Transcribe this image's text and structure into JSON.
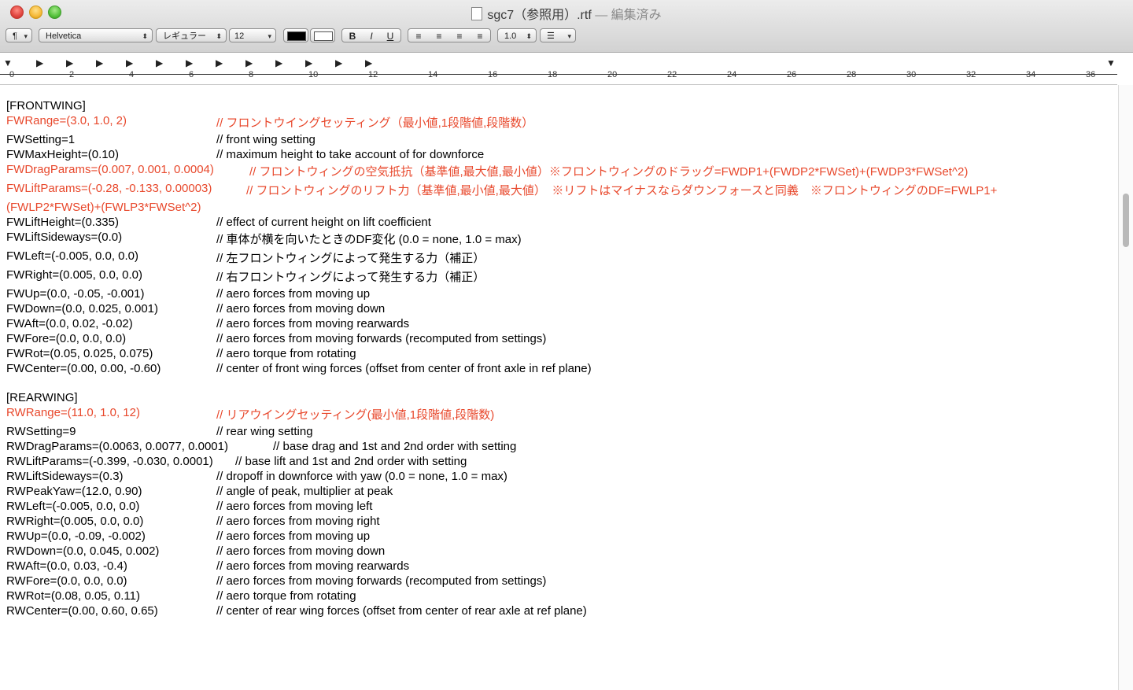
{
  "window": {
    "title": "sgc7（参照用）.rtf",
    "edited": "— 編集済み"
  },
  "toolbar": {
    "paragraph_btn": "¶",
    "font_family": "Helvetica",
    "font_style": "レギュラー",
    "font_size": "12",
    "bold": "B",
    "italic": "I",
    "underline": "U",
    "line_spacing": "1.0",
    "list_btn": "☰"
  },
  "ruler": {
    "labels": [
      "0",
      "2",
      "4",
      "6",
      "8",
      "10",
      "12",
      "14",
      "16",
      "18",
      "20",
      "22",
      "24",
      "26",
      "28",
      "30",
      "32",
      "34",
      "36"
    ]
  },
  "doc": {
    "frontwing_header": "[FRONTWING]",
    "l1_k": "FWRange=(3.0, 1.0, 2)",
    "l1_c": "// フロントウイングセッティング（最小値,1段階値,段階数）",
    "l2_k": "FWSetting=1",
    "l2_c": "// front wing setting",
    "l3_k": "FWMaxHeight=(0.10)",
    "l3_c": "// maximum height to take account of for downforce",
    "l4_k": "FWDragParams=(0.007, 0.001, 0.0004)",
    "l4_c": "// フロントウィングの空気抵抗（基準値,最大値,最小値）※フロントウィングのドラッグ=FWDP1+(FWDP2*FWSet)+(FWDP3*FWSet^2)",
    "l5_k": "FWLiftParams=(-0.28, -0.133, 0.00003)",
    "l5_c": "// フロントウィングのリフト力（基準値,最小値,最大値）　※リフトはマイナスならダウンフォースと同義　※フロントウィングのDF=FWLP1+",
    "l5b": "(FWLP2*FWSet)+(FWLP3*FWSet^2)",
    "l6_k": "FWLiftHeight=(0.335)",
    "l6_c": "// effect of current height on lift coefficient",
    "l7_k": "FWLiftSideways=(0.0)",
    "l7_c": "// 車体が横を向いたときのDF変化 (0.0 = none, 1.0 = max)",
    "l8_k": "FWLeft=(-0.005, 0.0, 0.0)",
    "l8_c": "// 左フロントウィングによって発生する力（補正）",
    "l9_k": "FWRight=(0.005, 0.0, 0.0)",
    "l9_c": "// 右フロントウィングによって発生する力（補正）",
    "l10_k": "FWUp=(0.0, -0.05, -0.001)",
    "l10_c": "// aero forces from moving up",
    "l11_k": "FWDown=(0.0, 0.025, 0.001)",
    "l11_c": "// aero forces from moving down",
    "l12_k": "FWAft=(0.0, 0.02, -0.02)",
    "l12_c": "// aero forces from moving rearwards",
    "l13_k": "FWFore=(0.0, 0.0, 0.0)",
    "l13_c": "// aero forces from moving forwards (recomputed from settings)",
    "l14_k": "FWRot=(0.05, 0.025, 0.075)",
    "l14_c": "// aero torque from rotating",
    "l15_k": "FWCenter=(0.00, 0.00, -0.60)",
    "l15_c": "// center of front wing forces (offset from center of front axle in ref plane)",
    "rearwing_header": "[REARWING]",
    "r1_k": "RWRange=(11.0, 1.0, 12)",
    "r1_c": "// リアウイングセッティング(最小値,1段階値,段階数)",
    "r2_k": "RWSetting=9",
    "r2_c": "// rear wing setting",
    "r3_k": "RWDragParams=(0.0063, 0.0077, 0.0001)",
    "r3_c": "// base drag and 1st and 2nd order with setting",
    "r4_k": "RWLiftParams=(-0.399, -0.030, 0.0001)",
    "r4_c": "// base lift and 1st and 2nd order with setting",
    "r5_k": "RWLiftSideways=(0.3)",
    "r5_c": "// dropoff in downforce with yaw (0.0 = none, 1.0 = max)",
    "r6_k": "RWPeakYaw=(12.0, 0.90)",
    "r6_c": "// angle of peak, multiplier at peak",
    "r7_k": "RWLeft=(-0.005, 0.0, 0.0)",
    "r7_c": "// aero forces from moving left",
    "r8_k": "RWRight=(0.005, 0.0, 0.0)",
    "r8_c": "// aero forces from moving right",
    "r9_k": "RWUp=(0.0, -0.09, -0.002)",
    "r9_c": "// aero forces from moving up",
    "r10_k": "RWDown=(0.0, 0.045, 0.002)",
    "r10_c": "// aero forces from moving down",
    "r11_k": "RWAft=(0.0, 0.03, -0.4)",
    "r11_c": "// aero forces from moving rearwards",
    "r12_k": "RWFore=(0.0, 0.0, 0.0)",
    "r12_c": "// aero forces from moving forwards (recomputed from settings)",
    "r13_k": "RWRot=(0.08, 0.05, 0.11)",
    "r13_c": "// aero torque from rotating",
    "r14_k": "RWCenter=(0.00, 0.60, 0.65)",
    "r14_c": "// center of rear wing forces (offset from center of rear axle at ref plane)"
  },
  "colors": {
    "highlight_text": "#e8482c"
  }
}
